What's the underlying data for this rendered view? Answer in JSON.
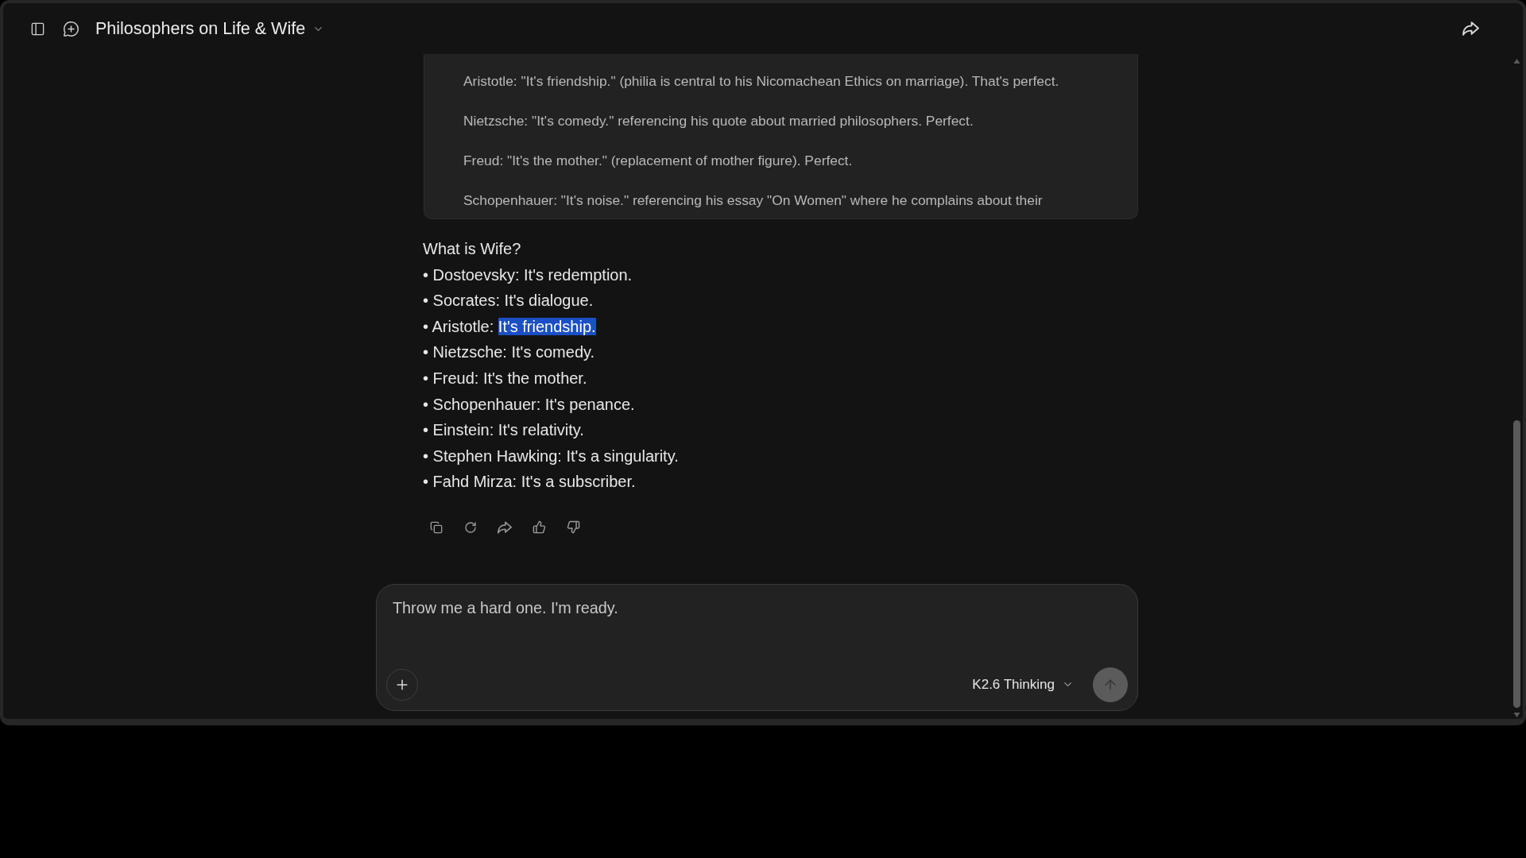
{
  "header": {
    "title": "Philosophers on Life & Wife"
  },
  "reasoning": {
    "paragraphs": [
      "Aristotle: \"It's friendship.\" (philia is central to his Nicomachean Ethics on marriage). That's perfect.",
      "Nietzsche: \"It's comedy.\" referencing his quote about married philosophers. Perfect.",
      "Freud: \"It's the mother.\" (replacement of mother figure). Perfect.",
      "Schopenhauer: \"It's noise.\" referencing his essay \"On Women\" where he complains about their"
    ]
  },
  "answer": {
    "heading": "What is Wife?",
    "items": [
      {
        "label": "• Dostoevsky:",
        "answer": "It's redemption.",
        "highlighted": false
      },
      {
        "label": "• Socrates:",
        "answer": "It's dialogue.",
        "highlighted": false
      },
      {
        "label": "• Aristotle:",
        "answer": "It's friendship.",
        "highlighted": true
      },
      {
        "label": "• Nietzsche:",
        "answer": "It's comedy.",
        "highlighted": false
      },
      {
        "label": "• Freud:",
        "answer": "It's the mother.",
        "highlighted": false
      },
      {
        "label": "• Schopenhauer:",
        "answer": "It's penance.",
        "highlighted": false
      },
      {
        "label": "• Einstein:",
        "answer": "It's relativity.",
        "highlighted": false
      },
      {
        "label": "• Stephen Hawking:",
        "answer": "It's a singularity.",
        "highlighted": false
      },
      {
        "label": "• Fahd Mirza:",
        "answer": "It's a subscriber.",
        "highlighted": false
      }
    ]
  },
  "composer": {
    "value": "Throw me a hard one. I'm ready.",
    "model": "K2.6 Thinking"
  }
}
